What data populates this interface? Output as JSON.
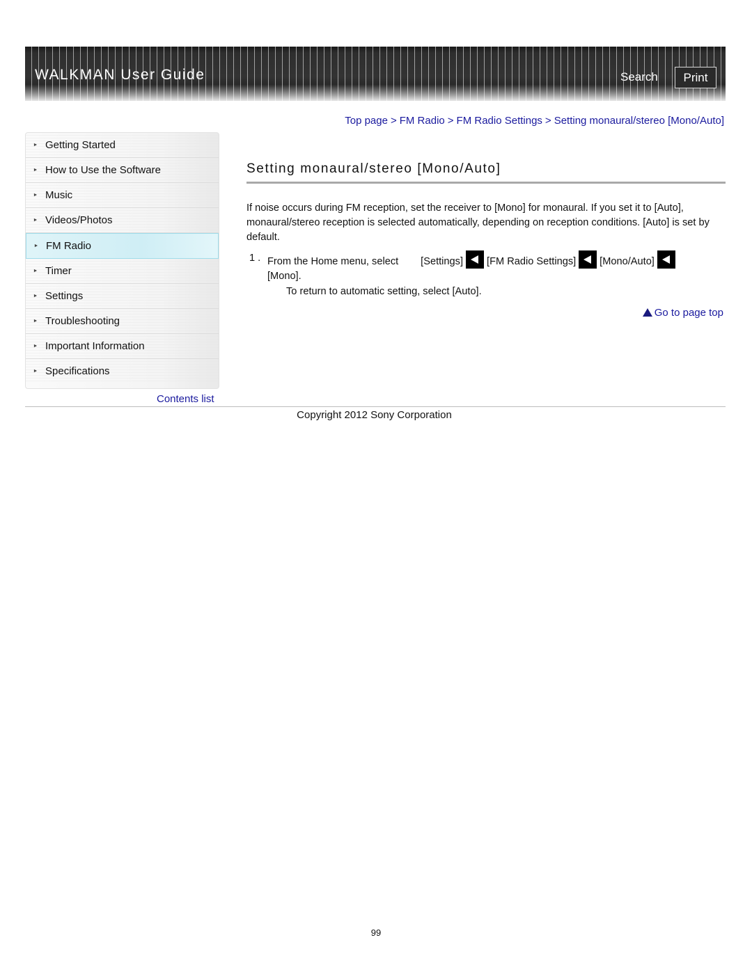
{
  "header": {
    "title": "WALKMAN User Guide",
    "search_label": "Search",
    "print_label": "Print"
  },
  "breadcrumb": {
    "items": [
      "Top page",
      "FM Radio",
      "FM Radio Settings",
      "Setting monaural/stereo [Mono/Auto]"
    ],
    "separator": ">"
  },
  "sidebar": {
    "items": [
      {
        "label": "Getting Started"
      },
      {
        "label": "How to Use the Software"
      },
      {
        "label": "Music"
      },
      {
        "label": "Videos/Photos"
      },
      {
        "label": "FM Radio",
        "active": true
      },
      {
        "label": "Timer"
      },
      {
        "label": "Settings"
      },
      {
        "label": "Troubleshooting"
      },
      {
        "label": "Important Information"
      },
      {
        "label": "Specifications"
      }
    ],
    "bullet": "►",
    "contents_link": "Contents list"
  },
  "main": {
    "title": "Setting monaural/stereo [Mono/Auto]",
    "intro": "If noise occurs during FM reception, set the receiver to [Mono] for monaural. If you set it to [Auto], monaural/stereo reception is selected automatically, depending on reception conditions. [Auto] is set by default.",
    "step": {
      "number": "1 .",
      "prefix": "From the Home menu, select",
      "path": [
        "[Settings]",
        "[FM Radio Settings]",
        "[Mono/Auto]"
      ],
      "final": "[Mono].",
      "note": "To return to automatic setting, select [Auto]."
    },
    "go_to_top": "Go to page top"
  },
  "footer": {
    "copyright": "Copyright 2012 Sony Corporation",
    "page_number": "99"
  },
  "colors": {
    "link": "#1a1a9e",
    "active_item_bg": "#cfeef5",
    "header_bg": "#333333"
  }
}
